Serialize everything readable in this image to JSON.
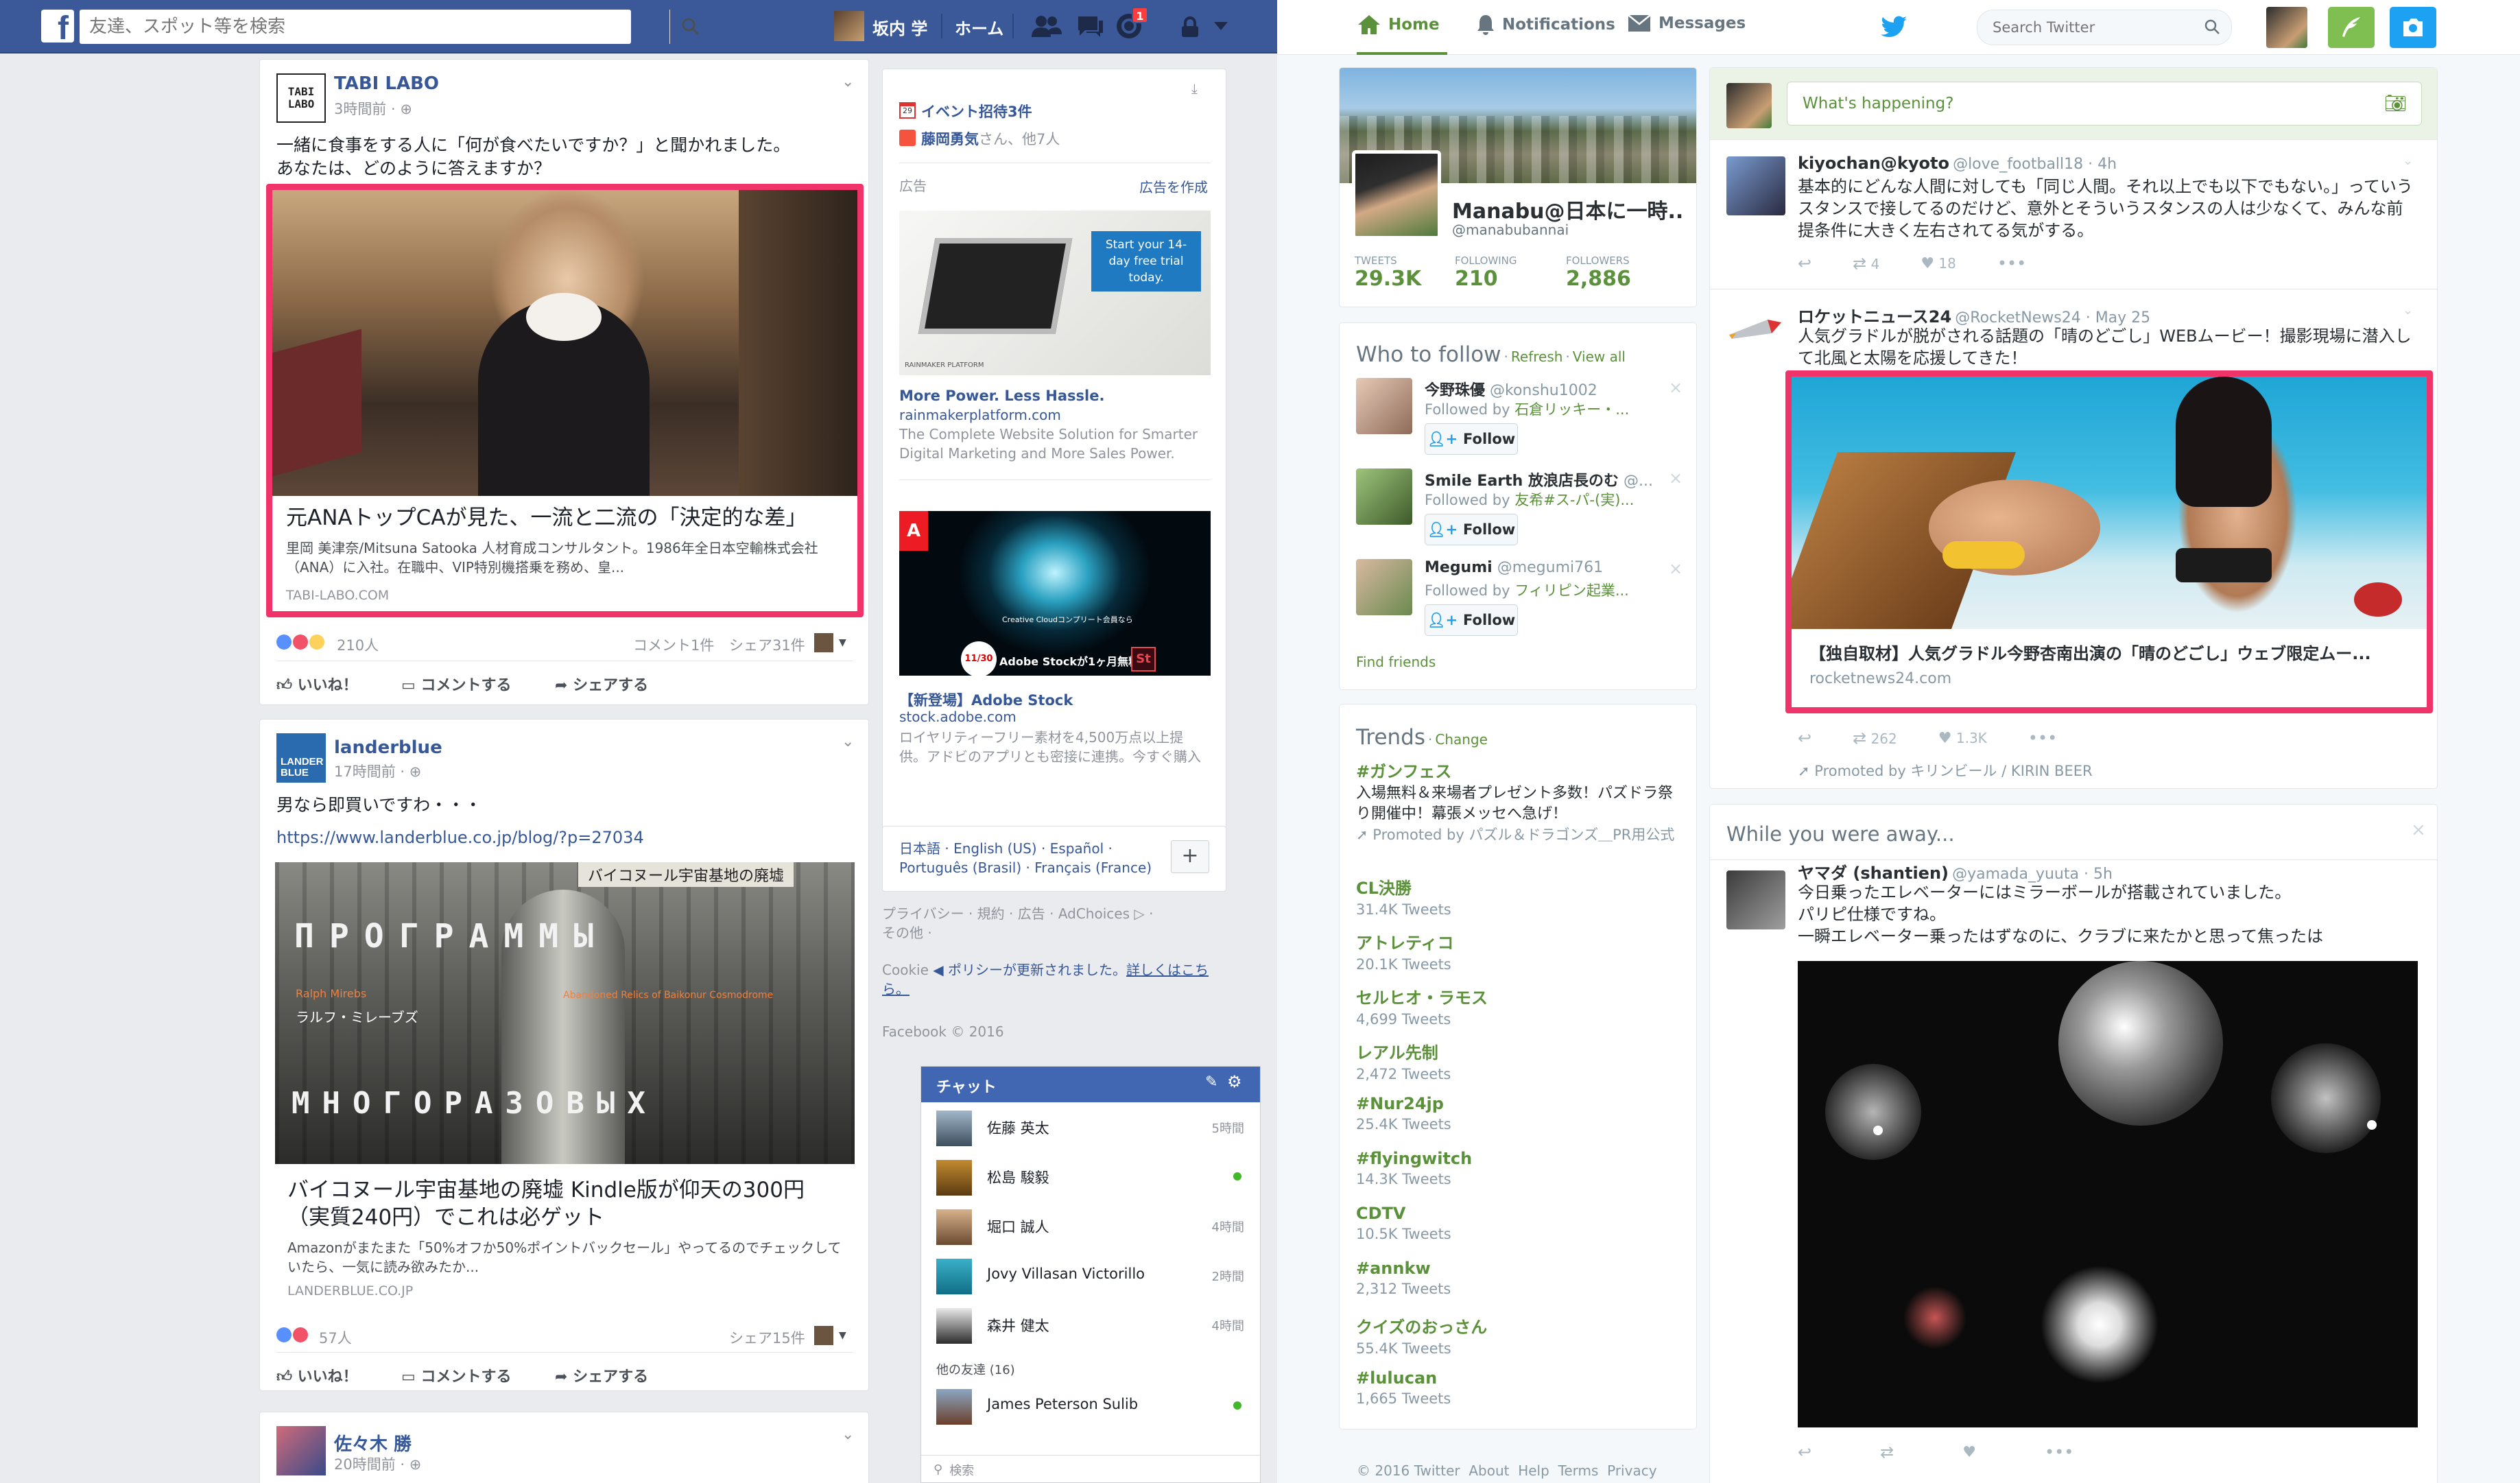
{
  "facebook": {
    "search_placeholder": "友達、スポット等を検索",
    "user_name": "坂内 学",
    "home_label": "ホーム",
    "notif_count": "1",
    "posts": [
      {
        "author": "TABI LABO",
        "logo_text": "TABI LABO",
        "time": "3時間前 · ",
        "text": "一緒に食事をする人に「何が食べたいですか？」と聞かれました。\nあなたは、どのように答えますか？",
        "link_title": "元ANAトップCAが見た、一流と二流の「決定的な差」",
        "link_desc": "里岡 美津奈/Mitsuna Satooka 人材育成コンサルタント。1986年全日本空輸株式会社（ANA）に入社。在職中、VIP特別機搭乗を務め、皇...",
        "link_domain": "TABI-LABO.COM",
        "reactions": "210人",
        "comments": "コメント1件",
        "shares": "シェア31件"
      },
      {
        "author": "landerblue",
        "logo_text": "LANDER BLUE",
        "time": "17時間前 · ",
        "text": "男なら即買いですわ・・・",
        "url": "https://www.landerblue.co.jp/blog/?p=27034",
        "image_caption": "バイコヌール宇宙基地の廃墟",
        "image_big1": "ПРОГРАММЫ",
        "image_big2": "МНОГОРАЗОВЫХ",
        "image_small1": "Ralph Mirebs",
        "image_small2": "ラルフ・ミレーブズ",
        "image_small3": "Abandoned Relics of Baikonur Cosmodrome",
        "link_title": "バイコヌール宇宙基地の廃墟 Kindle版が仰天の300円（実質240円）でこれは必ゲット",
        "link_desc": "Amazonがまたまた「50%オフか50%ポイントバックセール」やってるのでチェックしていたら、一気に読み欲みたか...",
        "link_domain": "LANDERBLUE.CO.JP",
        "reactions": "57人",
        "shares": "シェア15件"
      },
      {
        "author": "佐々木 勝",
        "time": "20時間前 · "
      }
    ],
    "actions": {
      "like": "いいね！",
      "comment": "コメントする",
      "share": "シェアする"
    },
    "right_rail": {
      "events": "イベント招待3件",
      "event_people": "藤岡勇気",
      "event_people_suffix": "さん、他7人",
      "ads_label": "広告",
      "create_ad": "広告を作成",
      "ad1_overlay": "Start your 14-day free trial today.",
      "ad1_brand": "RAINMAKER PLATFORM",
      "ad1_title": "More Power. Less Hassle.",
      "ad1_url": "rainmakerplatform.com",
      "ad1_desc": "The Complete Website Solution for Smarter Digital Marketing and More Sales Power.",
      "ad2_overlay_top": "Creative Cloudコンプリート会員なら",
      "ad2_badge": "11/30まで",
      "ad2_overlay": "Adobe Stockが1ヶ月無料",
      "ad2_logo": "St",
      "ad2_title": "【新登場】Adobe Stock",
      "ad2_url": "stock.adobe.com",
      "ad2_desc": "ロイヤリティーフリー素材を4,500万点以上提供。アドビのアプリとも密接に連携。今すぐ購入",
      "languages": "日本語 · English (US) · Español · Português (Brasil) · Français (France)",
      "footer_links": "プライバシー · 規約 · 広告 · AdChoices",
      "footer_more": "その他 ·",
      "cookie_prefix": "Cookie",
      "cookie_text": "ポリシーが更新されました。",
      "cookie_link": "詳しくはこちら。",
      "copyright": "Facebook © 2016"
    },
    "chat": {
      "title": "チャット",
      "rows": [
        {
          "name": "佐藤 英太",
          "status": "5時間"
        },
        {
          "name": "松島 駿毅",
          "status": "online"
        },
        {
          "name": "堀口 誠人",
          "status": "4時間"
        },
        {
          "name": "Jovy Villasan Victorillo",
          "status": "2時間"
        },
        {
          "name": "森井 健太",
          "status": "4時間"
        }
      ],
      "other_friends": "他の友達 (16)",
      "other_row": {
        "name": "James Peterson Sulib",
        "status": "online"
      },
      "search_placeholder": "検索"
    }
  },
  "twitter": {
    "nav": {
      "home": "Home",
      "notifications": "Notifications",
      "messages": "Messages"
    },
    "search_placeholder": "Search Twitter",
    "profile": {
      "name": "Manabu@日本に一時..",
      "handle": "@manabubannai",
      "tweets_label": "TWEETS",
      "tweets": "29.3K",
      "following_label": "FOLLOWING",
      "following": "210",
      "followers_label": "FOLLOWERS",
      "followers": "2,886"
    },
    "who_to_follow": {
      "title": "Who to follow",
      "refresh": "Refresh",
      "view_all": "View all",
      "sep": " · ",
      "follow_label": "Follow",
      "followed_by": "Followed by",
      "items": [
        {
          "name": "今野珠優",
          "handle": "@konshu1002",
          "followed": "石倉リッキー・..."
        },
        {
          "name": "Smile Earth 放浪店長のむ",
          "handle": "@...",
          "followed": "友希#ス-パ-(実)..."
        },
        {
          "name": "Megumi",
          "handle": "@megumi761",
          "followed": "フィリピン起業..."
        }
      ],
      "find_friends": "Find friends"
    },
    "trends": {
      "title": "Trends",
      "change": "Change",
      "sep": " · ",
      "items": [
        {
          "name": "#ガンフェス",
          "desc": "入場無料＆来場者プレゼント多数！パズドラ祭り開催中！幕張メッセへ急げ！",
          "promoted": "Promoted by パズル＆ドラゴンズ＿PR用公式"
        },
        {
          "name": "CL決勝",
          "count": "31.4K Tweets"
        },
        {
          "name": "アトレティコ",
          "count": "20.1K Tweets"
        },
        {
          "name": "セルヒオ・ラモス",
          "count": "4,699 Tweets"
        },
        {
          "name": "レアル先制",
          "count": "2,472 Tweets"
        },
        {
          "name": "#Nur24jp",
          "count": "25.4K Tweets"
        },
        {
          "name": "#flyingwitch",
          "count": "14.3K Tweets"
        },
        {
          "name": "CDTV",
          "count": "10.5K Tweets"
        },
        {
          "name": "#annkw",
          "count": "2,312 Tweets"
        },
        {
          "name": "クイズのおっさん",
          "count": "55.4K Tweets"
        },
        {
          "name": "#lulucan",
          "count": "1,665 Tweets"
        }
      ]
    },
    "footer": "© 2016 Twitter  About  Help  Terms  Privacy",
    "compose_placeholder": "What's happening?",
    "tweets": [
      {
        "name": "kiyochan@kyoto",
        "handle": "@love_football18 · 4h",
        "text": "基本的にどんな人間に対しても「同じ人間。それ以上でも以下でもない。」っていうスタンスで接してるのだけど、意外とそういうスタンスの人は少なくて、みんな前提条件に大きく左右されてる気がする。",
        "retweets": "4",
        "likes": "18"
      },
      {
        "name": "ロケットニュース24",
        "handle": "@RocketNews24 · May 25",
        "text": "人気グラドルが脱がされる話題の「晴のどごし」WEBムービー！撮影現場に潜入して北風と太陽を応援してきた！",
        "card_title": "【独自取材】人気グラドル今野杏南出演の「晴のどごし」ウェブ限定ムー...",
        "card_domain": "rocketnews24.com",
        "retweets": "262",
        "likes": "1.3K",
        "promoted": "Promoted by キリンビール / KIRIN BEER"
      }
    ],
    "away": {
      "title": "While you were away...",
      "name": "ヤマダ (shantien)",
      "handle": "@yamada_yuuta · 5h",
      "text": "今日乗ったエレベーターにはミラーボールが搭載されていました。\nパリピ仕様ですね。\n一瞬エレベーター乗ったはずなのに、クラブに来たかと思って焦ったは"
    }
  },
  "colors": {
    "facebook_blue": "#3b5998",
    "highlight": "#f0346a",
    "twitter_green": "#5c913b",
    "twitter_blue": "#1da1f2"
  }
}
